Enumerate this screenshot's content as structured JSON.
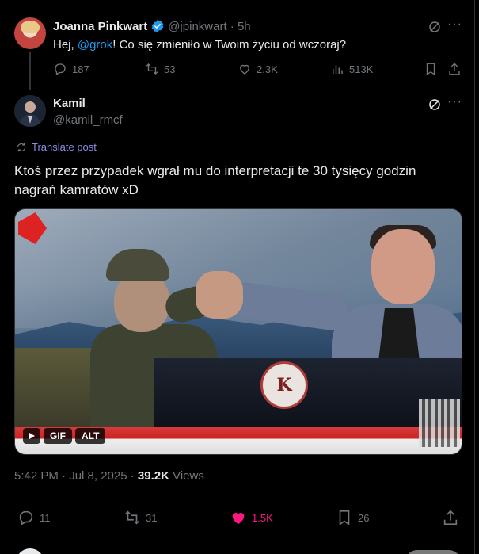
{
  "reply_tweet": {
    "author_name": "Joanna Pinkwart",
    "handle_time": "@jpinkwart · 5h",
    "text_before": "Hej, ",
    "mention": "@grok",
    "text_after": "! Co się zmieniło w Twoim życiu od wczoraj?",
    "replies": "187",
    "reposts": "53",
    "likes": "2.3K",
    "views": "513K"
  },
  "main_tweet": {
    "author_name": "Kamil",
    "handle": "@kamil_rmcf",
    "translate_label": "Translate post",
    "text": "Ktoś przez przypadek wgrał mu do interpretacji te 30 tysięcy godzin nagrań kamratów xD",
    "media": {
      "gif_label": "GIF",
      "alt_label": "ALT",
      "logo_text": "K"
    },
    "timestamp": "5:42 PM · Jul 8, 2025 · ",
    "views_count": "39.2K",
    "views_label": " Views",
    "replies": "11",
    "reposts": "31",
    "likes": "1.5K",
    "bookmarks": "26"
  },
  "colors": {
    "background": "#000000",
    "text": "#e7e9ea",
    "muted": "#71767b",
    "accent": "#1d9bf0",
    "like": "#f91880",
    "translate": "#8e8be8"
  },
  "icons": [
    "verified-badge-icon",
    "grok-icon",
    "more-icon",
    "reply-icon",
    "repost-icon",
    "like-icon",
    "views-icon",
    "bookmark-icon",
    "share-icon",
    "translate-icon",
    "play-icon"
  ]
}
